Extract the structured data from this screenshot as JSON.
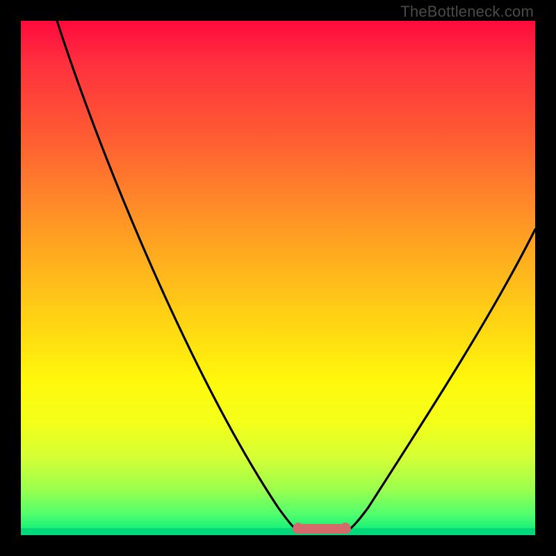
{
  "watermark": "TheBottleneck.com",
  "colors": {
    "frame": "#000000",
    "curve": "#000000",
    "flat_segment": "#d46a6a",
    "gradient_top": "#ff0a3d",
    "gradient_bottom": "#00e87a"
  },
  "chart_data": {
    "type": "line",
    "title": "",
    "xlabel": "",
    "ylabel": "",
    "xlim": [
      0,
      100
    ],
    "ylim": [
      0,
      100
    ],
    "series": [
      {
        "name": "bottleneck-curve",
        "x": [
          7,
          12,
          18,
          24,
          30,
          36,
          42,
          48,
          51,
          54,
          58,
          61,
          66,
          72,
          78,
          84,
          90,
          96,
          100
        ],
        "y": [
          100,
          89,
          78,
          66,
          55,
          43,
          31,
          18,
          9,
          2,
          0,
          0,
          2,
          10,
          20,
          31,
          42,
          53,
          60
        ]
      }
    ],
    "annotations": [
      {
        "name": "flat-min-segment",
        "x_start": 54,
        "x_end": 63,
        "y": 0
      }
    ]
  }
}
